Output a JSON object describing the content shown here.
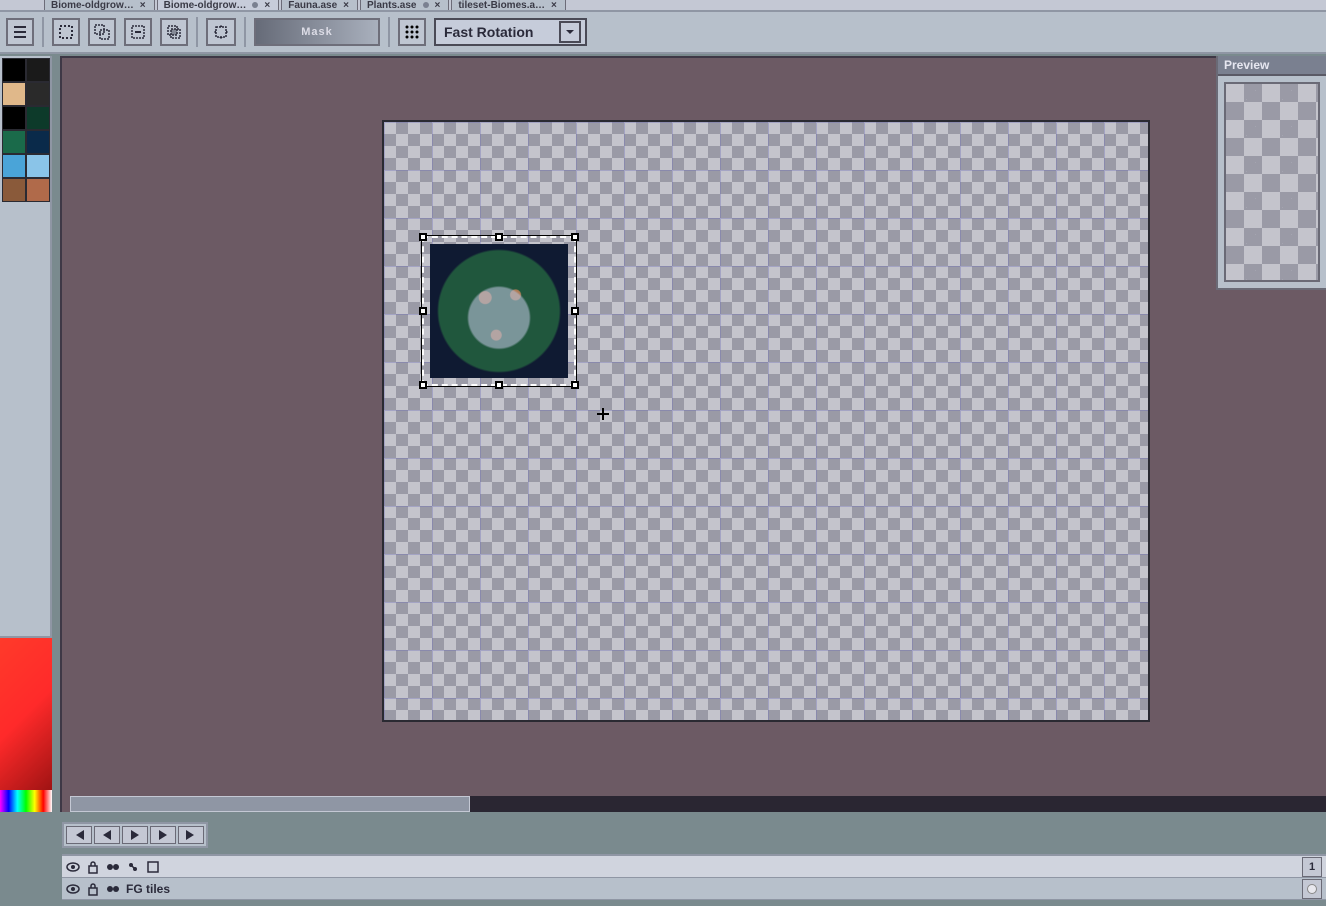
{
  "tabs": [
    {
      "label": "Biome-oldgrow…",
      "dirty": false,
      "active": false
    },
    {
      "label": "Biome-oldgrow…",
      "dirty": true,
      "active": true
    },
    {
      "label": "Fauna.ase",
      "dirty": false,
      "active": false
    },
    {
      "label": "Plants.ase",
      "dirty": true,
      "active": false
    },
    {
      "label": "tileset-Biomes.a…",
      "dirty": false,
      "active": false
    }
  ],
  "toolbar": {
    "mask_label": "Mask",
    "rotation_mode": "Fast Rotation"
  },
  "palette_colors": [
    "#000000",
    "#1a1a1a",
    "#e0b88a",
    "#2a2a2a",
    "#000000",
    "#0d3a2a",
    "#1a6a4a",
    "#0a2a4a",
    "#4aa4d8",
    "#8ac4e8",
    "#8a5a3a",
    "#b06a4a"
  ],
  "preview": {
    "title": "Preview"
  },
  "timeline": {
    "frame_number": "1",
    "layer_name": "FG tiles"
  }
}
